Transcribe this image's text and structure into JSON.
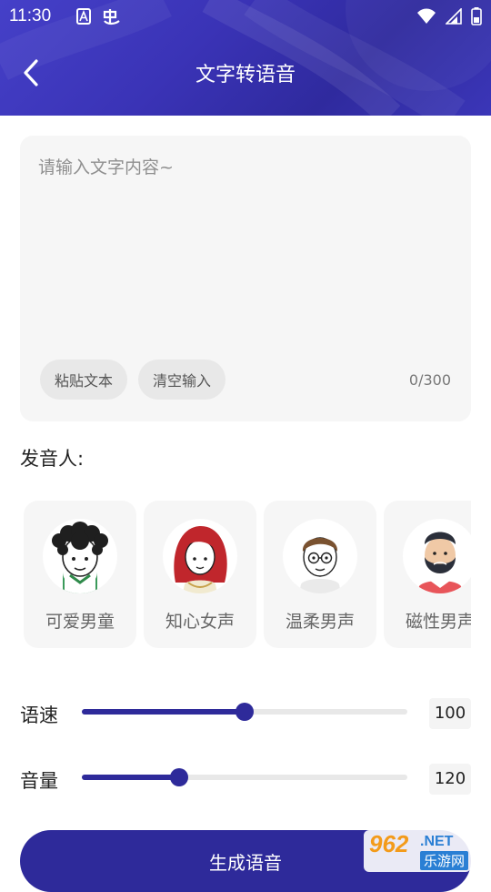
{
  "status_bar": {
    "time": "11:30"
  },
  "header": {
    "title": "文字转语音"
  },
  "text_input": {
    "placeholder": "请输入文字内容~",
    "value": "",
    "paste_label": "粘贴文本",
    "clear_label": "清空输入",
    "char_count": "0/300"
  },
  "voices": {
    "label": "发音人:",
    "items": [
      {
        "name": "可爱男童",
        "icon": "boy-avatar-icon"
      },
      {
        "name": "知心女声",
        "icon": "woman-avatar-icon"
      },
      {
        "name": "温柔男声",
        "icon": "glasses-man-avatar-icon"
      },
      {
        "name": "磁性男声",
        "icon": "bearded-man-avatar-icon"
      }
    ]
  },
  "sliders": {
    "speed": {
      "label": "语速",
      "value": "100",
      "fraction": 0.5
    },
    "volume": {
      "label": "音量",
      "value": "120",
      "fraction": 0.3
    }
  },
  "generate_button": {
    "label": "生成语音"
  },
  "watermark": {
    "number": "962",
    "suffix": ".NET",
    "site": "乐游网"
  },
  "colors": {
    "accent": "#2e2a9a",
    "header": "#3a33b6"
  }
}
